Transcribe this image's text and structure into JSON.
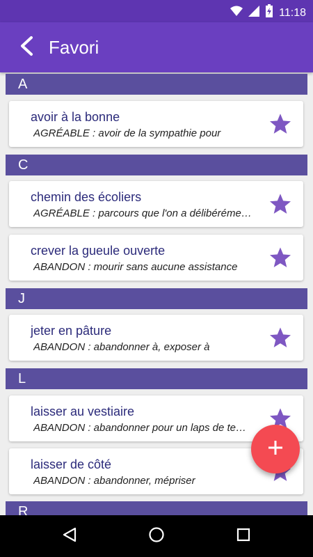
{
  "status_bar": {
    "time": "11:18"
  },
  "app_bar": {
    "title": "Favori"
  },
  "sections": {
    "a": "A",
    "c": "C",
    "j": "J",
    "l": "L",
    "r": "R"
  },
  "entries": [
    {
      "term": "avoir à la bonne",
      "definition": "AGRÉABLE : avoir de la sympathie pour"
    },
    {
      "term": "chemin des écoliers",
      "definition": "AGRÉABLE : parcours que l'on a délibérément choisi plus long"
    },
    {
      "term": "crever la gueule ouverte",
      "definition": "ABANDON : mourir sans aucune assistance"
    },
    {
      "term": "jeter en pâture",
      "definition": "ABANDON : abandonner à, exposer à"
    },
    {
      "term": "laisser au vestiaire",
      "definition": "ABANDON : abandonner pour un laps de temps"
    },
    {
      "term": "laisser de côté",
      "definition": "ABANDON : abandonner, mépriser"
    }
  ],
  "colors": {
    "status_bar": "#5e35b1",
    "app_bar": "#6a3fc0",
    "section_header": "#5a4f9e",
    "star": "#7e57c2",
    "fab": "#f44a52"
  },
  "icons": [
    "wifi-icon",
    "signal-icon",
    "battery-charging-icon",
    "back-arrow-icon",
    "star-icon",
    "plus-icon",
    "nav-back-icon",
    "nav-home-icon",
    "nav-recents-icon"
  ]
}
